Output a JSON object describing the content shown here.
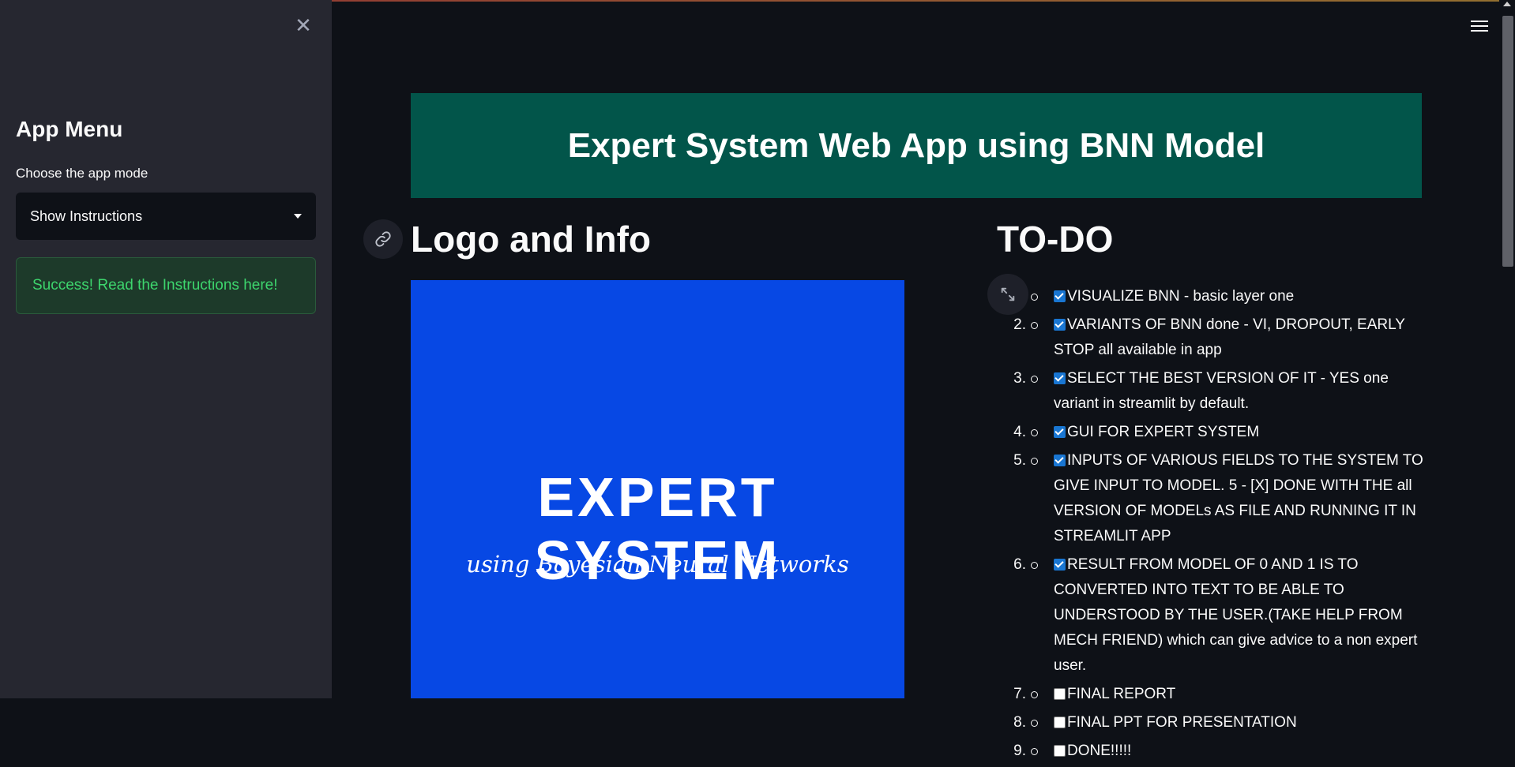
{
  "sidebar": {
    "title": "App Menu",
    "select_label": "Choose the app mode",
    "select_value": "Show Instructions",
    "success_message": "Success! Read the Instructions here!",
    "close_icon": "close-icon"
  },
  "main": {
    "header_title": "Expert System Web App using BNN Model",
    "logo_section": {
      "heading": "Logo and Info",
      "image_title": "EXPERT SYSTEM",
      "image_subtitle": "using Bayesian Neural Networks"
    },
    "todo": {
      "heading": "TO-DO",
      "items": [
        {
          "num": "",
          "checked": true,
          "text": "VISUALIZE BNN - basic layer one"
        },
        {
          "num": "2.",
          "checked": true,
          "text": "VARIANTS OF BNN done - VI, DROPOUT, EARLY STOP all available in app"
        },
        {
          "num": "3.",
          "checked": true,
          "text": "SELECT THE BEST VERSION OF IT - YES one variant in streamlit by default."
        },
        {
          "num": "4.",
          "checked": true,
          "text": "GUI FOR EXPERT SYSTEM"
        },
        {
          "num": "5.",
          "checked": true,
          "text": "INPUTS OF VARIOUS FIELDS TO THE SYSTEM TO GIVE INPUT TO MODEL. 5 - [X] DONE WITH THE all VERSION OF MODELs AS FILE AND RUNNING IT IN STREAMLIT APP"
        },
        {
          "num": "6.",
          "checked": true,
          "text": "RESULT FROM MODEL OF 0 AND 1 IS TO CONVERTED INTO TEXT TO BE ABLE TO UNDERSTOOD BY THE USER.(TAKE HELP FROM MECH FRIEND) which can give advice to a non expert user."
        },
        {
          "num": "7.",
          "checked": false,
          "text": "FINAL REPORT"
        },
        {
          "num": "8.",
          "checked": false,
          "text": "FINAL PPT FOR PRESENTATION"
        },
        {
          "num": "9.",
          "checked": false,
          "text": "DONE!!!!!"
        }
      ]
    }
  },
  "icons": {
    "menu": "hamburger-menu-icon",
    "link": "link-icon",
    "expand": "expand-icon"
  },
  "colors": {
    "background": "#0e1117",
    "sidebar": "#262730",
    "header_banner": "#02554a",
    "logo_background": "#0748e4",
    "success_text": "#3dd56d",
    "success_bg": "#1d3a2a"
  }
}
